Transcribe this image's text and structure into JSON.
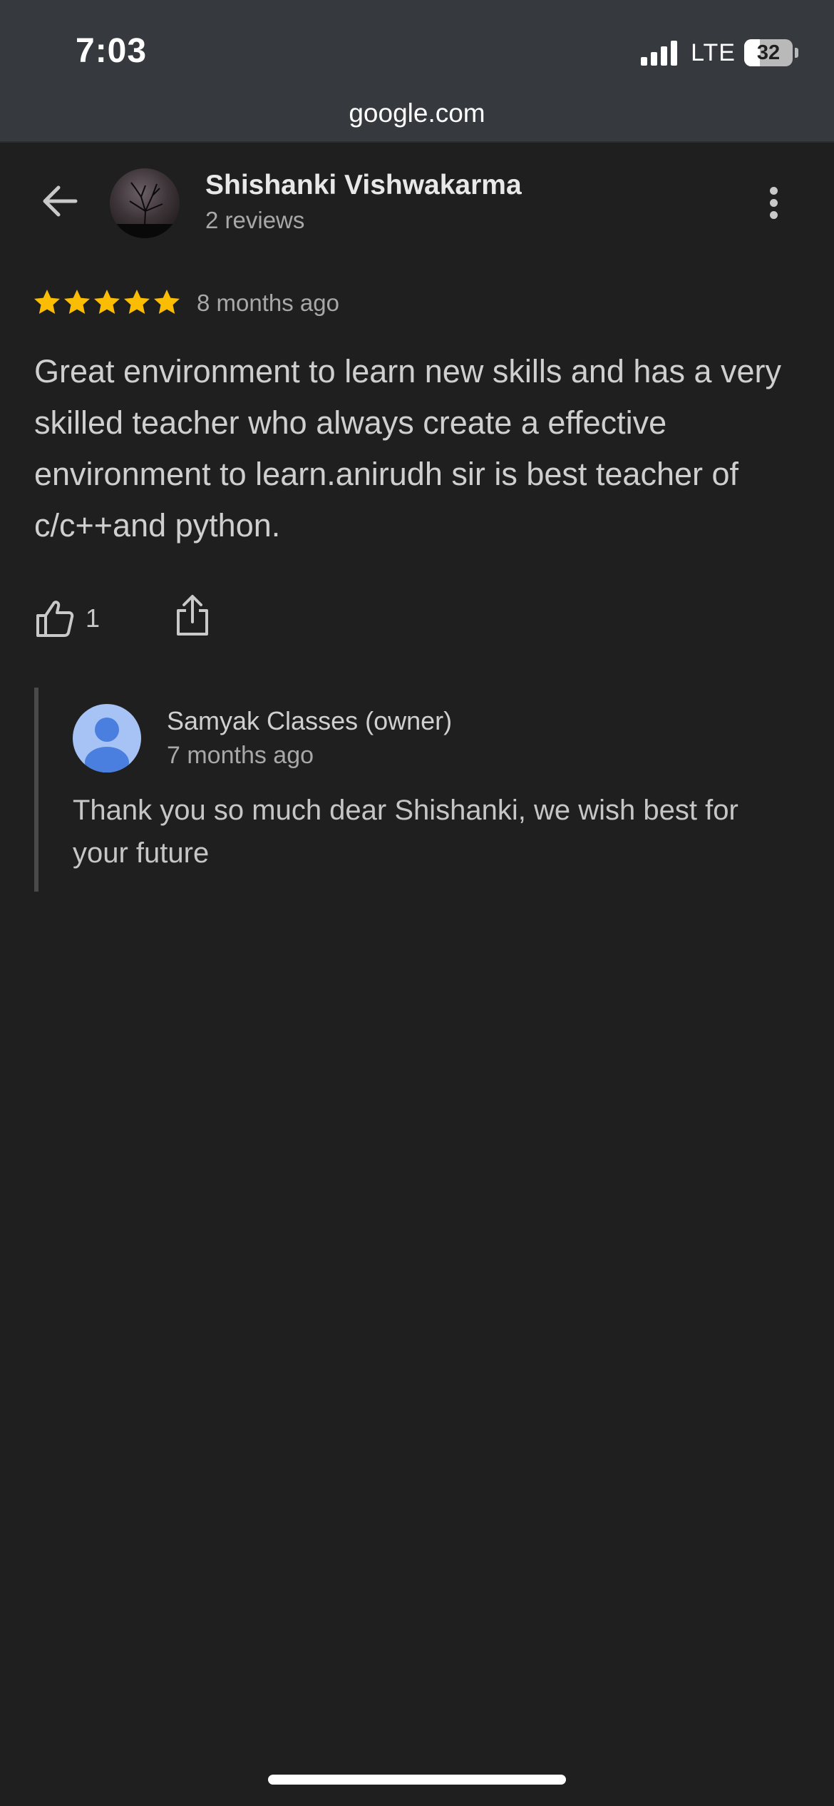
{
  "status_bar": {
    "time": "7:03",
    "network": "LTE",
    "battery": "32",
    "battery_level_percent": 32
  },
  "browser": {
    "url": "google.com"
  },
  "reviewer": {
    "name": "Shishanki Vishwakarma",
    "review_count": "2 reviews"
  },
  "review": {
    "rating": 5,
    "time_ago": "8 months ago",
    "text": "Great environment to learn new skills and has a very skilled teacher who always create a effective environment to learn.anirudh sir is best teacher of c/c++and python.",
    "likes": "1"
  },
  "owner_reply": {
    "name": "Samyak Classes (owner)",
    "time_ago": "7 months ago",
    "text": "Thank you so much dear Shishanki, we wish best for your future"
  },
  "colors": {
    "background": "#1f1f1f",
    "header": "#363a3e",
    "star": "#fbbc04",
    "owner_avatar": "#4a7fe0"
  },
  "icons": {
    "back": "arrow-left-icon",
    "more": "more-vert-icon",
    "like": "thumbs-up-icon",
    "share": "share-icon",
    "star": "star-icon",
    "owner_avatar": "person-icon"
  }
}
